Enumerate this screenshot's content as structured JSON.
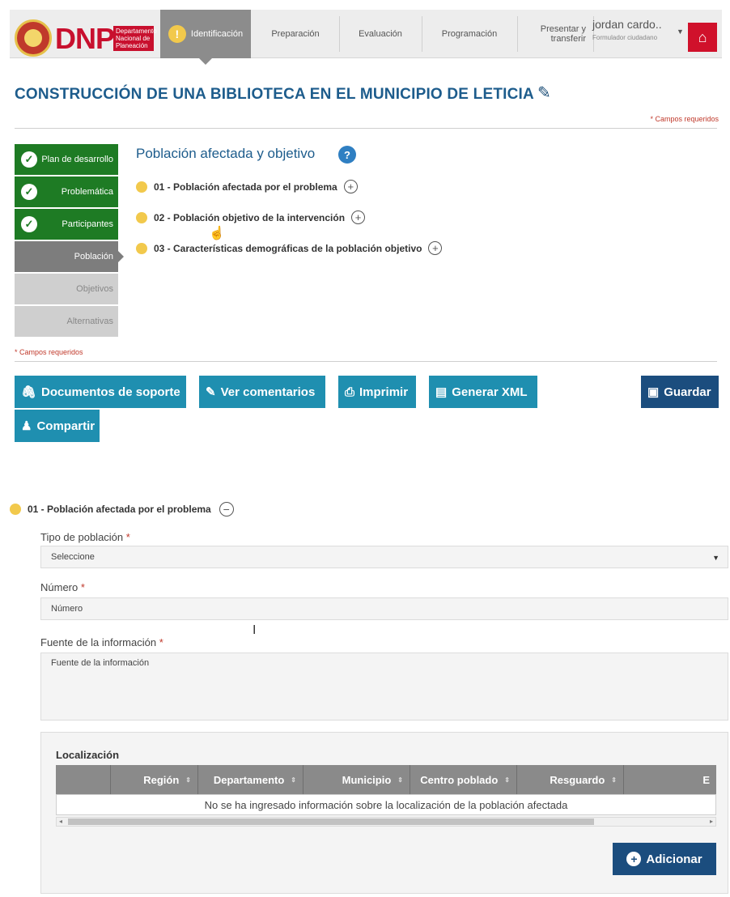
{
  "header": {
    "logo": "DNP",
    "logo_subtitle": "Departamento Nacional de Planeación",
    "steps": [
      {
        "label": "Identificación",
        "active": true
      },
      {
        "label": "Preparación"
      },
      {
        "label": "Evaluación"
      },
      {
        "label": "Programación"
      },
      {
        "label": "Presentar y transferir"
      }
    ],
    "user": {
      "name": "jordan cardo..",
      "role": "Formulador ciudadano"
    },
    "home_icon": "home-icon"
  },
  "project": {
    "title": "CONSTRUCCIÓN DE UNA BIBLIOTECA EN EL MUNICIPIO DE LETICIA",
    "required_note": "* Campos requeridos"
  },
  "sidebar": {
    "items": [
      {
        "label": "Plan de desarrollo",
        "state": "done"
      },
      {
        "label": "Problemática",
        "state": "done"
      },
      {
        "label": "Participantes",
        "state": "done"
      },
      {
        "label": "Población",
        "state": "active"
      },
      {
        "label": "Objetivos",
        "state": "idle"
      },
      {
        "label": "Alternativas",
        "state": "idle"
      }
    ]
  },
  "section": {
    "title": "Población afectada y objetivo",
    "help_icon": "?",
    "accordions": [
      {
        "label": "01 - Población afectada por el problema"
      },
      {
        "label": "02 - Población objetivo de la intervención"
      },
      {
        "label": "03 - Características demográficas de la población objetivo"
      }
    ]
  },
  "actions": {
    "documentos": "Documentos de soporte",
    "comentarios": "Ver comentarios",
    "imprimir": "Imprimir",
    "xml": "Generar XML",
    "guardar": "Guardar",
    "compartir": "Compartir"
  },
  "form": {
    "open_accordion": "01 - Población afectada por el problema",
    "tipo_label": "Tipo de población",
    "tipo_value": "Seleccione",
    "numero_label": "Número",
    "numero_placeholder": "Número",
    "fuente_label": "Fuente de la información",
    "fuente_placeholder": "Fuente de la información",
    "required_mark": "*"
  },
  "localizacion": {
    "title": "Localización",
    "columns": [
      "",
      "Región",
      "Departamento",
      "Municipio",
      "Centro poblado",
      "Resguardo",
      "E"
    ],
    "empty_message": "No se ha ingresado información sobre la localización de la población afectada",
    "add_button": "Adicionar"
  },
  "colors": {
    "done_green": "#1e7b24",
    "brand_red": "#c8102e",
    "action_blue": "#1f8fb0",
    "primary_navy": "#1b4d7e"
  }
}
